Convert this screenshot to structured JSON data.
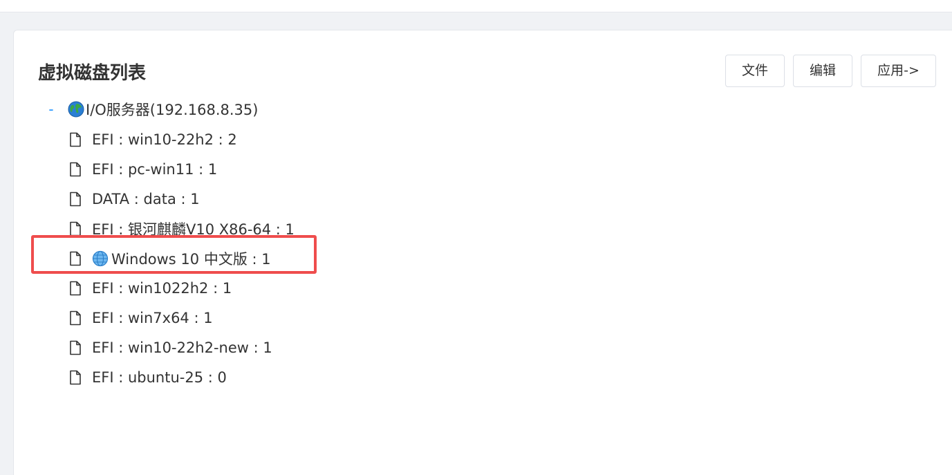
{
  "header": {
    "title": "虚拟磁盘列表"
  },
  "toolbar": {
    "file_label": "文件",
    "edit_label": "编辑",
    "apply_label": "应用->"
  },
  "tree": {
    "toggle": "-",
    "root_label": "I/O服务器(192.168.8.35)",
    "items": [
      {
        "label": "EFI : win10-22h2 : 2",
        "icon": "file-icon"
      },
      {
        "label": "EFI : pc-win11 : 1",
        "icon": "file-icon"
      },
      {
        "label": "DATA : data : 1",
        "icon": "file-icon"
      },
      {
        "label": "EFI : 银河麒麟V10 X86-64 : 1",
        "icon": "file-icon"
      },
      {
        "label": "Windows 10 中文版 : 1",
        "icon": "file-icon",
        "badge_icon": "globe-icon",
        "highlighted": true
      },
      {
        "label": "EFI : win1022h2 : 1",
        "icon": "file-icon"
      },
      {
        "label": "EFI : win7x64 : 1",
        "icon": "file-icon"
      },
      {
        "label": "EFI : win10-22h2-new : 1",
        "icon": "file-icon"
      },
      {
        "label": "EFI : ubuntu-25 : 0",
        "icon": "file-icon"
      }
    ]
  },
  "colors": {
    "accent": "#1890ff",
    "highlight_border": "#ef4d4d",
    "background": "#f0f2f5"
  }
}
